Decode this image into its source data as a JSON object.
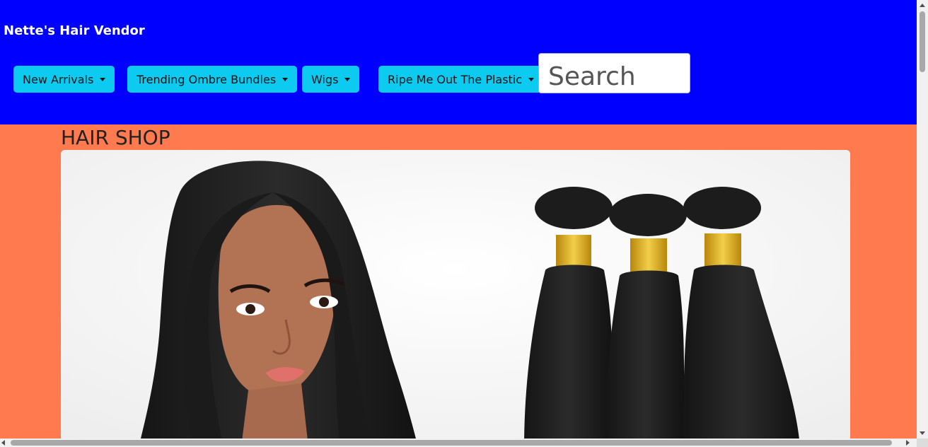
{
  "navbar": {
    "brand": "Nette's Hair Vendor",
    "background": "#0000ff",
    "menus": [
      {
        "label": "New Arrivals",
        "icon": "caret-down-icon"
      },
      {
        "label": "Trending Ombre Bundles",
        "icon": "caret-down-icon"
      },
      {
        "label": "Wigs",
        "icon": "caret-down-icon"
      },
      {
        "label": "Ripe Me Out The Plastic",
        "icon": "caret-down-icon"
      }
    ],
    "menu_color": "#0dcaf0",
    "search": {
      "placeholder": "Search",
      "value": ""
    }
  },
  "main": {
    "title": "HAIR SHOP",
    "background": "#ff7b4f",
    "hero": {
      "description_icon": "product-image"
    }
  }
}
